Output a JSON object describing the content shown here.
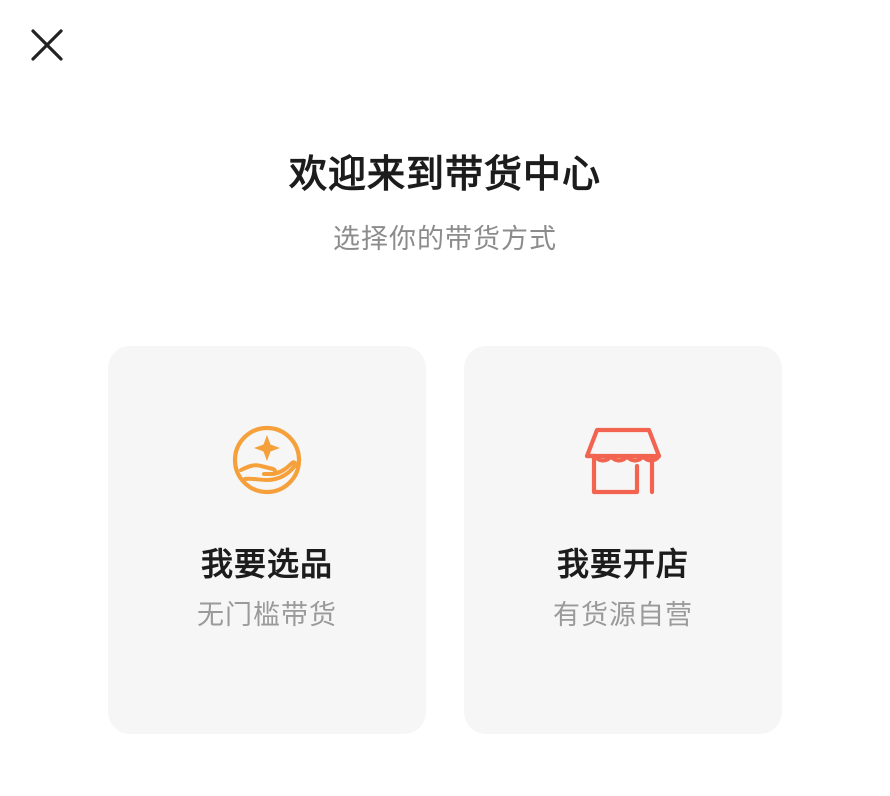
{
  "header": {
    "title": "欢迎来到带货中心",
    "subtitle": "选择你的带货方式",
    "close_icon": "close-icon"
  },
  "options": [
    {
      "title": "我要选品",
      "description": "无门槛带货",
      "icon": "hand-star-icon",
      "color": "#F5A03A"
    },
    {
      "title": "我要开店",
      "description": "有货源自营",
      "icon": "store-icon",
      "color": "#F26450"
    }
  ]
}
